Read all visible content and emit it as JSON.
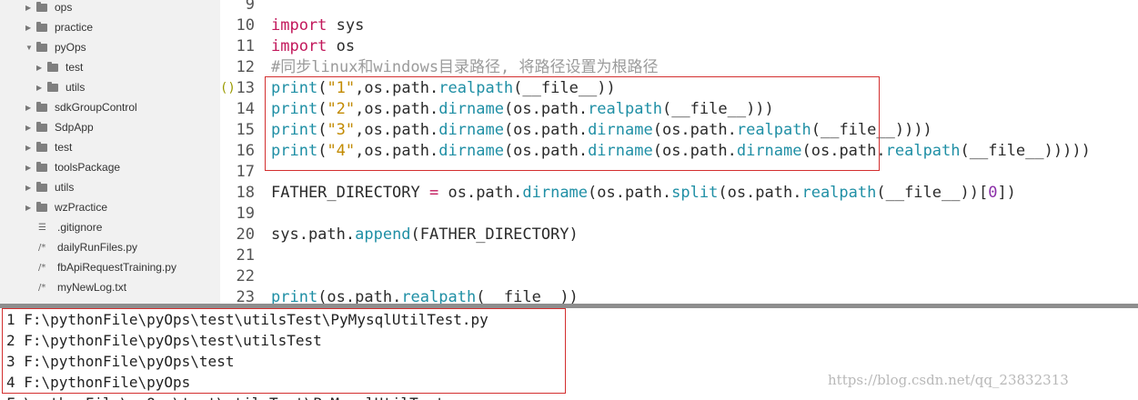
{
  "sidebar": {
    "items": [
      {
        "label": "ops",
        "type": "folder",
        "expanded": false,
        "depth": 0
      },
      {
        "label": "practice",
        "type": "folder",
        "expanded": false,
        "depth": 0
      },
      {
        "label": "pyOps",
        "type": "folder",
        "expanded": true,
        "depth": 0
      },
      {
        "label": "test",
        "type": "folder",
        "expanded": false,
        "depth": 1
      },
      {
        "label": "utils",
        "type": "folder",
        "expanded": false,
        "depth": 1
      },
      {
        "label": "sdkGroupControl",
        "type": "folder",
        "expanded": false,
        "depth": 0
      },
      {
        "label": "SdpApp",
        "type": "folder",
        "expanded": false,
        "depth": 0
      },
      {
        "label": "test",
        "type": "folder",
        "expanded": false,
        "depth": 0
      },
      {
        "label": "toolsPackage",
        "type": "folder",
        "expanded": false,
        "depth": 0
      },
      {
        "label": "utils",
        "type": "folder",
        "expanded": false,
        "depth": 0
      },
      {
        "label": "wzPractice",
        "type": "folder",
        "expanded": false,
        "depth": 0
      },
      {
        "label": ".gitignore",
        "type": "file",
        "icon": "lines-icon"
      },
      {
        "label": "dailyRunFiles.py",
        "type": "file",
        "icon": "python-file-icon"
      },
      {
        "label": "fbApiRequestTraining.py",
        "type": "file",
        "icon": "python-file-icon"
      },
      {
        "label": "myNewLog.txt",
        "type": "file",
        "icon": "text-file-icon"
      }
    ]
  },
  "editor": {
    "lines": [
      {
        "num": "9",
        "tokens": []
      },
      {
        "num": "10",
        "tokens": [
          [
            "kw",
            "import"
          ],
          [
            "t",
            " sys"
          ]
        ]
      },
      {
        "num": "11",
        "tokens": [
          [
            "kw",
            "import"
          ],
          [
            "t",
            " os"
          ]
        ]
      },
      {
        "num": "12",
        "tokens": [
          [
            "cm",
            "#同步linux和windows目录路径, 将路径设置为根路径"
          ]
        ]
      },
      {
        "num": "13",
        "fold": "()",
        "tokens": [
          [
            "fn",
            "print"
          ],
          [
            "t",
            "("
          ],
          [
            "str",
            "\"1\""
          ],
          [
            "t",
            ",os.path."
          ],
          [
            "fn",
            "realpath"
          ],
          [
            "t",
            "(__file__))"
          ]
        ]
      },
      {
        "num": "14",
        "tokens": [
          [
            "fn",
            "print"
          ],
          [
            "t",
            "("
          ],
          [
            "str",
            "\"2\""
          ],
          [
            "t",
            ",os.path."
          ],
          [
            "fn",
            "dirname"
          ],
          [
            "t",
            "(os.path."
          ],
          [
            "fn",
            "realpath"
          ],
          [
            "t",
            "(__file__)))"
          ]
        ]
      },
      {
        "num": "15",
        "tokens": [
          [
            "fn",
            "print"
          ],
          [
            "t",
            "("
          ],
          [
            "str",
            "\"3\""
          ],
          [
            "t",
            ",os.path."
          ],
          [
            "fn",
            "dirname"
          ],
          [
            "t",
            "(os.path."
          ],
          [
            "fn",
            "dirname"
          ],
          [
            "t",
            "(os.path."
          ],
          [
            "fn",
            "realpath"
          ],
          [
            "t",
            "(__file__))))"
          ]
        ]
      },
      {
        "num": "16",
        "tokens": [
          [
            "fn",
            "print"
          ],
          [
            "t",
            "("
          ],
          [
            "str",
            "\"4\""
          ],
          [
            "t",
            ",os.path."
          ],
          [
            "fn",
            "dirname"
          ],
          [
            "t",
            "(os.path."
          ],
          [
            "fn",
            "dirname"
          ],
          [
            "t",
            "(os.path."
          ],
          [
            "fn",
            "dirname"
          ],
          [
            "t",
            "(os.path."
          ],
          [
            "fn",
            "realpath"
          ],
          [
            "t",
            "(__file__)))))"
          ]
        ]
      },
      {
        "num": "17",
        "tokens": []
      },
      {
        "num": "18",
        "tokens": [
          [
            "t",
            "FATHER_DIRECTORY "
          ],
          [
            "op",
            "="
          ],
          [
            "t",
            " os.path."
          ],
          [
            "fn",
            "dirname"
          ],
          [
            "t",
            "(os.path."
          ],
          [
            "fn",
            "split"
          ],
          [
            "t",
            "(os.path."
          ],
          [
            "fn",
            "realpath"
          ],
          [
            "t",
            "(__file__))["
          ],
          [
            "num",
            "0"
          ],
          [
            "t",
            "])"
          ]
        ]
      },
      {
        "num": "19",
        "tokens": []
      },
      {
        "num": "20",
        "tokens": [
          [
            "t",
            "sys.path."
          ],
          [
            "fn",
            "append"
          ],
          [
            "t",
            "(FATHER_DIRECTORY)"
          ]
        ]
      },
      {
        "num": "21",
        "tokens": []
      },
      {
        "num": "22",
        "tokens": []
      },
      {
        "num": "23",
        "tokens": [
          [
            "fn",
            "print"
          ],
          [
            "t",
            "(os.path."
          ],
          [
            "fn",
            "realpath"
          ],
          [
            "t",
            "(__file__))"
          ]
        ]
      }
    ]
  },
  "console": {
    "lines": [
      "1 F:\\pythonFile\\pyOps\\test\\utilsTest\\PyMysqlUtilTest.py",
      "2 F:\\pythonFile\\pyOps\\test\\utilsTest",
      "3 F:\\pythonFile\\pyOps\\test",
      "4 F:\\pythonFile\\pyOps",
      "F:\\pythonFile\\pyOps\\test\\utilsTest\\PyMysqlUtilTest.py"
    ]
  },
  "watermark": "https://blog.csdn.net/qq_23832313",
  "colors": {
    "keyword": "#c2185b",
    "function": "#1f8fa5",
    "string": "#c28a00",
    "number": "#8b2fa8",
    "comment": "#9b9b9b",
    "highlight_border": "#d32f2f"
  }
}
